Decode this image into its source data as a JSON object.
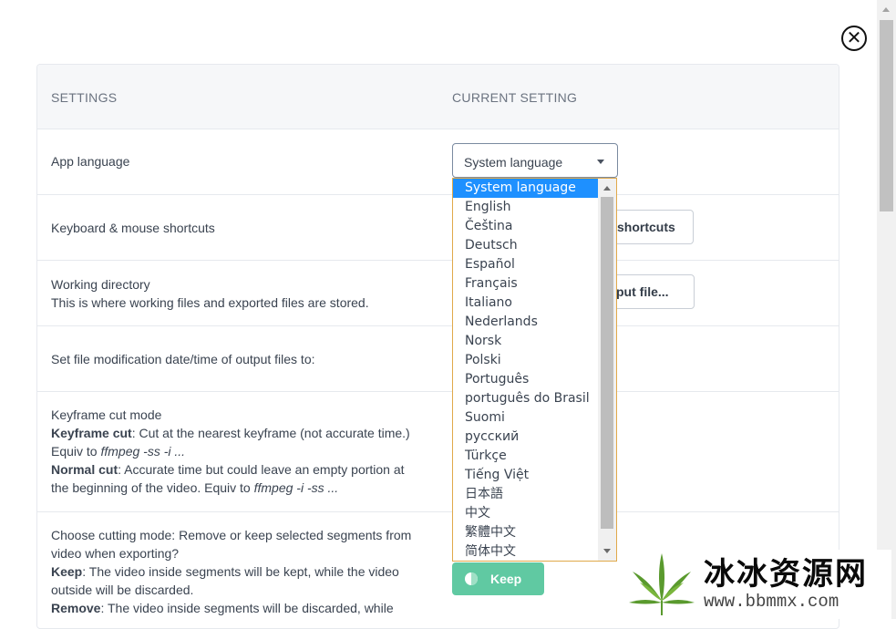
{
  "header": {
    "col_settings": "SETTINGS",
    "col_current": "CURRENT SETTING"
  },
  "rows": {
    "app_language": {
      "label": "App language",
      "select_value": "System language"
    },
    "shortcuts": {
      "label": "Keyboard & mouse shortcuts",
      "button": "shortcuts"
    },
    "working_dir": {
      "label": "Working directory",
      "desc": "This is where working files and exported files are stored.",
      "button": "put file..."
    },
    "mod_date": {
      "label": "Set file modification date/time of output files to:"
    },
    "keyframe": {
      "title": "Keyframe cut mode",
      "kf_bold": "Keyframe cut",
      "kf_text": ": Cut at the nearest keyframe (not accurate time.) Equiv to ",
      "kf_code": "ffmpeg -ss -i ...",
      "nc_bold": "Normal cut",
      "nc_text": ": Accurate time but could leave an empty portion at the beginning of the video. Equiv to ",
      "nc_code": "ffmpeg -i -ss ..."
    },
    "cut_mode": {
      "title": "Choose cutting mode: Remove or keep selected segments from video when exporting?",
      "keep_bold": "Keep",
      "keep_text": ": The video inside segments will be kept, while the video outside will be discarded.",
      "remove_bold": "Remove",
      "remove_text": ": The video inside segments will be discarded, while",
      "button": "Keep"
    }
  },
  "language_options": [
    "System language",
    "English",
    "Čeština",
    "Deutsch",
    "Español",
    "Français",
    "Italiano",
    "Nederlands",
    "Norsk",
    "Polski",
    "Português",
    "português do Brasil",
    "Suomi",
    "русский",
    "Türkçe",
    "Tiếng Việt",
    "日本語",
    "中文",
    "繁體中文",
    "简体中文"
  ],
  "watermark": {
    "text": "冰冰资源网",
    "url": "www.bbmmx.com"
  },
  "icons": {
    "close": "close-circle-icon",
    "keep": "yin-yang-icon"
  }
}
